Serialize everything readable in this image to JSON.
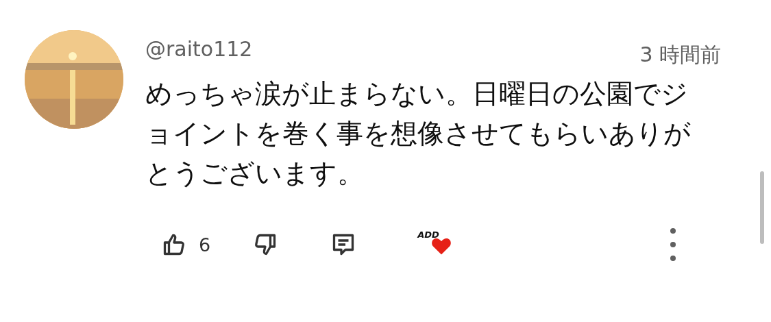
{
  "comment": {
    "author": "@raito112",
    "time": "3 時間前",
    "text": "めっちゃ涙が止まらない。日曜日の公園でジョイントを巻く事を想像させてもらいありがとうございます。",
    "like_count": "6",
    "creator_heart": {
      "logo_text": "ADD",
      "hearted": true
    }
  }
}
